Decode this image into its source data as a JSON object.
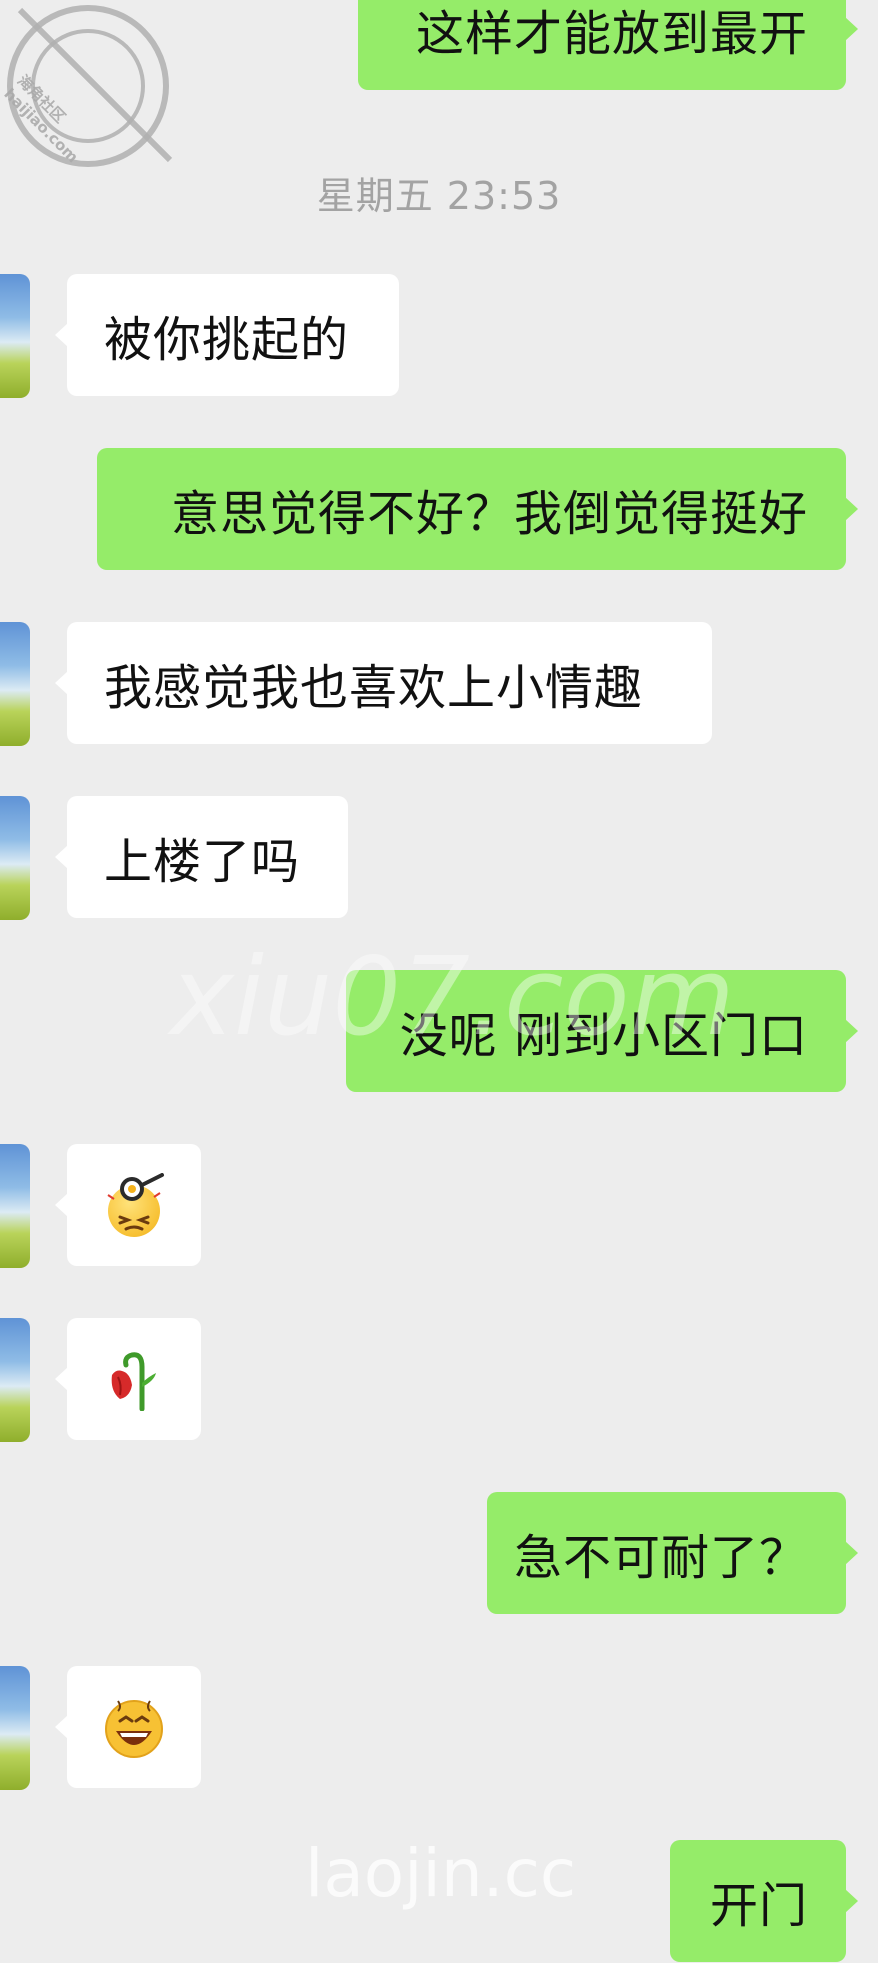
{
  "timestamp": "星期五 23:53",
  "messages": [
    {
      "direction": "outgoing",
      "text": "这样才能放到最开"
    },
    {
      "direction": "incoming",
      "text": "被你挑起的"
    },
    {
      "direction": "outgoing",
      "text": "意思觉得不好？我倒觉得挺好"
    },
    {
      "direction": "incoming",
      "text": "我感觉我也喜欢上小情趣"
    },
    {
      "direction": "incoming",
      "text": "上楼了吗"
    },
    {
      "direction": "outgoing",
      "text": "没呢 刚到小区门口"
    },
    {
      "direction": "incoming",
      "emoji": "frying-pan-dizzy-face-emoji"
    },
    {
      "direction": "incoming",
      "emoji": "wilted-rose-emoji"
    },
    {
      "direction": "outgoing",
      "text": "急不可耐了？"
    },
    {
      "direction": "incoming",
      "emoji": "grinning-face-emoji"
    },
    {
      "direction": "outgoing",
      "text": "开门"
    }
  ],
  "watermarks": {
    "stamp_line1": "海角社区",
    "stamp_line2": "haijiao.com",
    "center": "xiu07.com",
    "bottom": "laojin.cc"
  },
  "colors": {
    "background": "#ededed",
    "outgoing_bubble": "#95ec69",
    "incoming_bubble": "#ffffff",
    "timestamp_text": "#a3a3a3"
  }
}
